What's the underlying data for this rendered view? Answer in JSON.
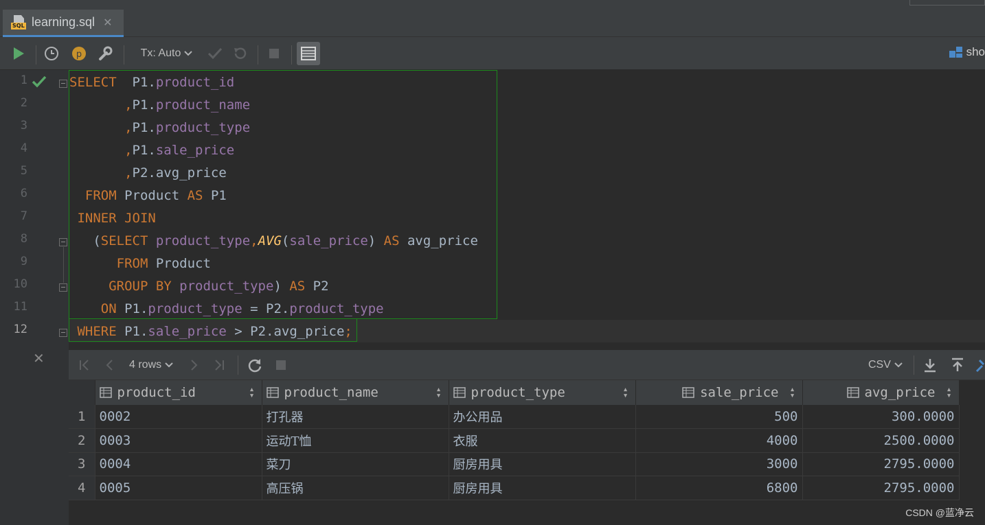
{
  "tab": {
    "title": "learning.sql",
    "icon_label": "SQL",
    "close": "✕"
  },
  "toolbar": {
    "tx_mode": "Tx: Auto",
    "right_label": "sho"
  },
  "editor": {
    "current_line": 12,
    "line_numbers": [
      "1",
      "2",
      "3",
      "4",
      "5",
      "6",
      "7",
      "8",
      "9",
      "10",
      "11",
      "12"
    ]
  },
  "results": {
    "rows_label": "4 rows",
    "export_format": "CSV",
    "columns": [
      "product_id",
      "product_name",
      "product_type",
      "sale_price",
      "avg_price"
    ],
    "rows": [
      [
        "1",
        "0002",
        "打孔器",
        "办公用品",
        "500",
        "300.0000"
      ],
      [
        "2",
        "0003",
        "运动T恤",
        "衣服",
        "4000",
        "2500.0000"
      ],
      [
        "3",
        "0004",
        "菜刀",
        "厨房用具",
        "3000",
        "2795.0000"
      ],
      [
        "4",
        "0005",
        "高压锅",
        "厨房用具",
        "6800",
        "2795.0000"
      ]
    ]
  },
  "watermark": "CSDN @蓝净云",
  "colors": {
    "keyword": "#cc7832",
    "identifier": "#9876aa",
    "function": "#ffc66d",
    "plain": "#a9b7c6",
    "selection_border": "#1c8a1c"
  }
}
